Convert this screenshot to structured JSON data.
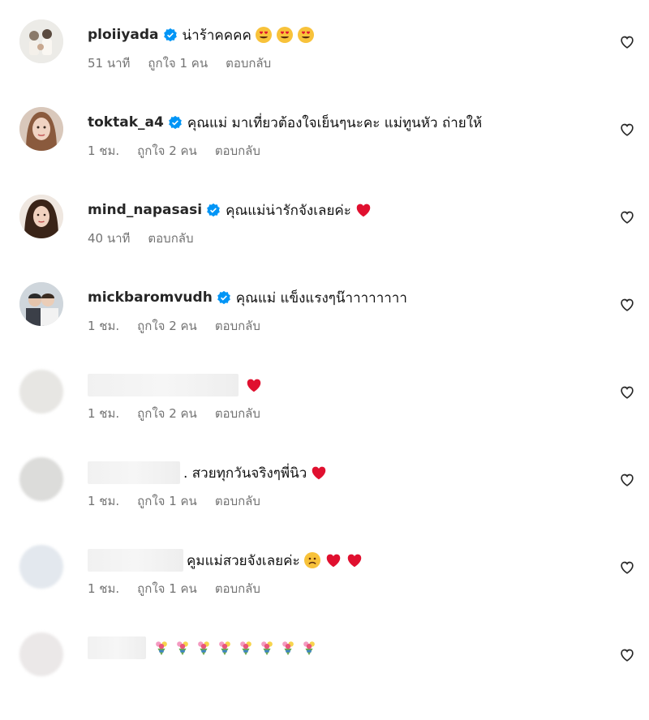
{
  "comments": [
    {
      "username": "ploiiyada",
      "verified": true,
      "text": "น่าร้าคคคค",
      "emojis": [
        "heart-eyes",
        "heart-eyes",
        "heart-eyes"
      ],
      "time": "51 นาที",
      "likes": "ถูกใจ 1 คน",
      "reply": "ตอบกลับ",
      "avatar": "photo"
    },
    {
      "username": "toktak_a4",
      "verified": true,
      "text": "คุณแม่ มาเที่ยวต้องใจเย็นๆนะคะ แม่ทูนหัว ถ่ายให้",
      "emojis": [],
      "time": "1 ชม.",
      "likes": "ถูกใจ 2 คน",
      "reply": "ตอบกลับ",
      "avatar": "photo"
    },
    {
      "username": "mind_napasasi",
      "verified": true,
      "text": "คุณแม่น่ารักจังเลยค่ะ",
      "emojis": [
        "red-heart"
      ],
      "time": "40 นาที",
      "likes": "",
      "reply": "ตอบกลับ",
      "avatar": "photo"
    },
    {
      "username": "mickbaromvudh",
      "verified": true,
      "text": "คุณแม่ แข็งแรงๆน๊าาาาาาาา",
      "emojis": [],
      "time": "1 ชม.",
      "likes": "ถูกใจ 2 คน",
      "reply": "ตอบกลับ",
      "avatar": "photo"
    },
    {
      "username": "",
      "verified": false,
      "text": "",
      "emojis": [
        "red-heart"
      ],
      "time": "1 ชม.",
      "likes": "ถูกใจ 2 คน",
      "reply": "ตอบกลับ",
      "avatar": "blurred"
    },
    {
      "username": "",
      "verified": false,
      "text": ". สวยทุกวันจริงๆพี่นิว",
      "emojis": [
        "red-heart"
      ],
      "time": "1 ชม.",
      "likes": "ถูกใจ 1 คน",
      "reply": "ตอบกลับ",
      "avatar": "blurred"
    },
    {
      "username": "",
      "verified": false,
      "text": "คูมแม่สวยจังเลยค่ะ",
      "emojis": [
        "frowning-face",
        "red-heart",
        "red-heart"
      ],
      "time": "1 ชม.",
      "likes": "ถูกใจ 1 คน",
      "reply": "ตอบกลับ",
      "avatar": "blurred"
    },
    {
      "username": "",
      "verified": false,
      "text": "",
      "emojis": [
        "bouquet",
        "bouquet",
        "bouquet",
        "bouquet",
        "bouquet",
        "bouquet",
        "bouquet",
        "bouquet"
      ],
      "time": "",
      "likes": "",
      "reply": "",
      "avatar": "blurred"
    }
  ],
  "colors": {
    "verified": "#0095f6",
    "meta": "#737373",
    "heart": "#e0102f"
  }
}
